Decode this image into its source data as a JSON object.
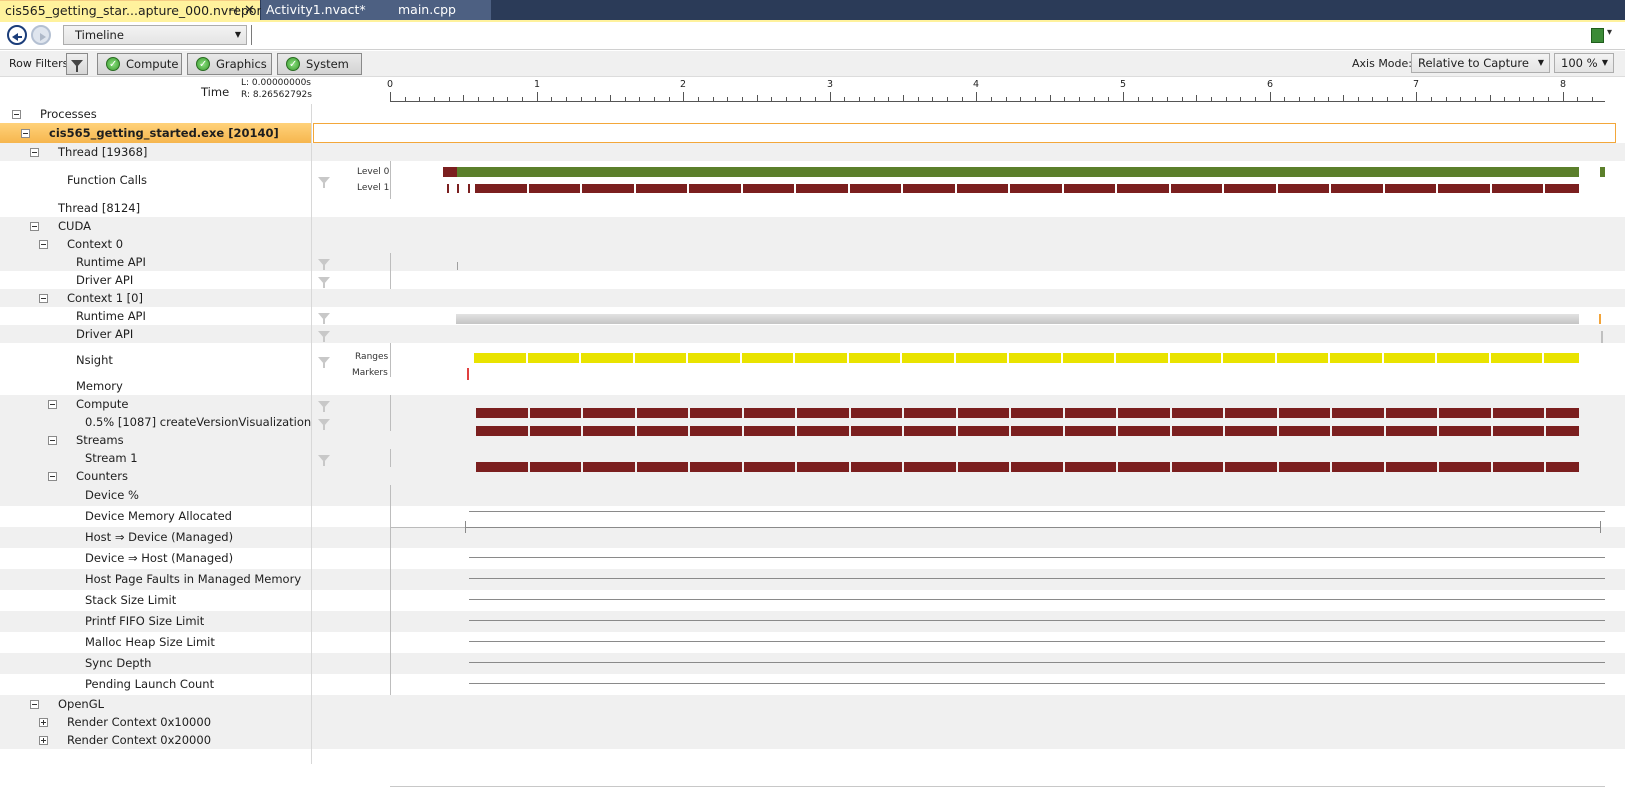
{
  "tabs": [
    {
      "label": "cis565_getting_star...apture_000.nvreport",
      "active": true,
      "pin": "⊣",
      "close": "✕"
    },
    {
      "label": "Activity1.nvact*",
      "active": false
    },
    {
      "label": "main.cpp",
      "active": false
    }
  ],
  "toolbar": {
    "view_select": "Timeline",
    "axis_mode_label": "Axis Mode:",
    "axis_mode_value": "Relative to Capture",
    "zoom_value": "100 %"
  },
  "filters": {
    "label": "Row Filters",
    "buttons": [
      "Compute",
      "Graphics",
      "System"
    ]
  },
  "time": {
    "label": "Time",
    "left": "L:  0.00000000s",
    "right": "R:  8.26562792s",
    "ticks": [
      "0",
      "1",
      "2",
      "3",
      "4",
      "5",
      "6",
      "7",
      "8"
    ]
  },
  "rows": {
    "processes": "Processes",
    "process": "cis565_getting_started.exe [20140]",
    "thread1": "Thread [19368]",
    "function_calls": "Function Calls",
    "level0": "Level 0",
    "level1": "Level 1",
    "thread2": "Thread [8124]",
    "cuda": "CUDA",
    "context0": "Context 0",
    "runtime_api_0": "Runtime API",
    "driver_api_0": "Driver API",
    "context1": "Context 1 [0]",
    "runtime_api_1": "Runtime API",
    "driver_api_1": "Driver API",
    "nsight": "Nsight",
    "ranges": "Ranges",
    "markers": "Markers",
    "memory": "Memory",
    "compute": "Compute",
    "kernel": "0.5% [1087] createVersionVisualization",
    "streams": "Streams",
    "stream1": "Stream 1",
    "counters": "Counters",
    "device_pct": "Device %",
    "dev_mem_alloc": "Device Memory Allocated",
    "h2d": "Host ⇒ Device (Managed)",
    "d2h": "Device ⇒ Host (Managed)",
    "host_page_faults": "Host Page Faults in Managed Memory",
    "stack_size": "Stack Size Limit",
    "printf_fifo": "Printf FIFO Size Limit",
    "malloc_heap": "Malloc Heap Size Limit",
    "sync_depth": "Sync Depth",
    "pending_launch": "Pending Launch Count",
    "opengl": "OpenGL",
    "render_ctx1": "Render Context 0x10000",
    "render_ctx2": "Render Context 0x20000"
  },
  "colors": {
    "tabbar": "#2b3b58",
    "active_tab": "#fff29d",
    "selected_row": "#f6b64e",
    "level0_bar": "#5b7f2b",
    "dark_red_bar": "#7b1f1f",
    "ranges_bar": "#e9e300"
  }
}
